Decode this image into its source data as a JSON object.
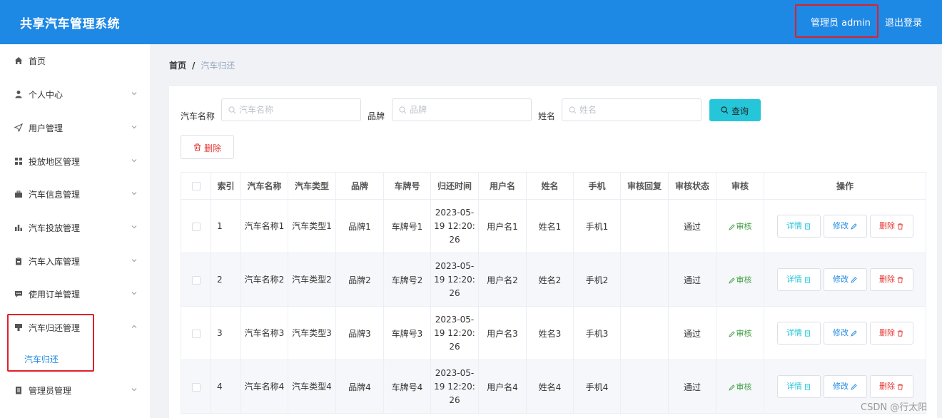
{
  "header": {
    "app_title": "共享汽车管理系统",
    "admin_label": "管理员 admin",
    "logout_label": "退出登录"
  },
  "sidebar": {
    "items": [
      {
        "label": "首页",
        "icon": "home-icon"
      },
      {
        "label": "个人中心",
        "icon": "user-icon"
      },
      {
        "label": "用户管理",
        "icon": "send-icon"
      },
      {
        "label": "投放地区管理",
        "icon": "grid-icon"
      },
      {
        "label": "汽车信息管理",
        "icon": "briefcase-icon"
      },
      {
        "label": "汽车投放管理",
        "icon": "bar-chart-icon"
      },
      {
        "label": "汽车入库管理",
        "icon": "clipboard-icon"
      },
      {
        "label": "使用订单管理",
        "icon": "chat-icon"
      },
      {
        "label": "汽车归还管理",
        "icon": "return-icon"
      },
      {
        "label": "管理员管理",
        "icon": "document-icon"
      }
    ],
    "active_sub": "汽车归还"
  },
  "breadcrumb": {
    "home": "首页",
    "sep": "/",
    "current": "汽车归还"
  },
  "filters": {
    "car_name_label": "汽车名称",
    "car_name_placeholder": "汽车名称",
    "brand_label": "品牌",
    "brand_placeholder": "品牌",
    "name_label": "姓名",
    "name_placeholder": "姓名",
    "query_label": "查询"
  },
  "actions": {
    "delete_label": "删除"
  },
  "table": {
    "headers": [
      "索引",
      "汽车名称",
      "汽车类型",
      "品牌",
      "车牌号",
      "归还时间",
      "用户名",
      "姓名",
      "手机",
      "审核回复",
      "审核状态",
      "审核",
      "操作"
    ],
    "rows": [
      {
        "index": "1",
        "car_name": "汽车名称1",
        "car_type": "汽车类型1",
        "brand": "品牌1",
        "plate": "车牌号1",
        "return_time": "2023-05-19 12:20:26",
        "username": "用户名1",
        "name": "姓名1",
        "phone": "手机1",
        "reply": "",
        "status": "通过"
      },
      {
        "index": "2",
        "car_name": "汽车名称2",
        "car_type": "汽车类型2",
        "brand": "品牌2",
        "plate": "车牌号2",
        "return_time": "2023-05-19 12:20:26",
        "username": "用户名2",
        "name": "姓名2",
        "phone": "手机2",
        "reply": "",
        "status": "通过"
      },
      {
        "index": "3",
        "car_name": "汽车名称3",
        "car_type": "汽车类型3",
        "brand": "品牌3",
        "plate": "车牌号3",
        "return_time": "2023-05-19 12:20:26",
        "username": "用户名3",
        "name": "姓名3",
        "phone": "手机3",
        "reply": "",
        "status": "通过"
      },
      {
        "index": "4",
        "car_name": "汽车名称4",
        "car_type": "汽车类型4",
        "brand": "品牌4",
        "plate": "车牌号4",
        "return_time": "2023-05-19 12:20:26",
        "username": "用户名4",
        "name": "姓名4",
        "phone": "手机4",
        "reply": "",
        "status": "通过"
      }
    ],
    "audit_label": "审核",
    "detail_label": "详情",
    "edit_label": "修改",
    "delete_label": "删除"
  },
  "watermark": "CSDN @行太阳"
}
